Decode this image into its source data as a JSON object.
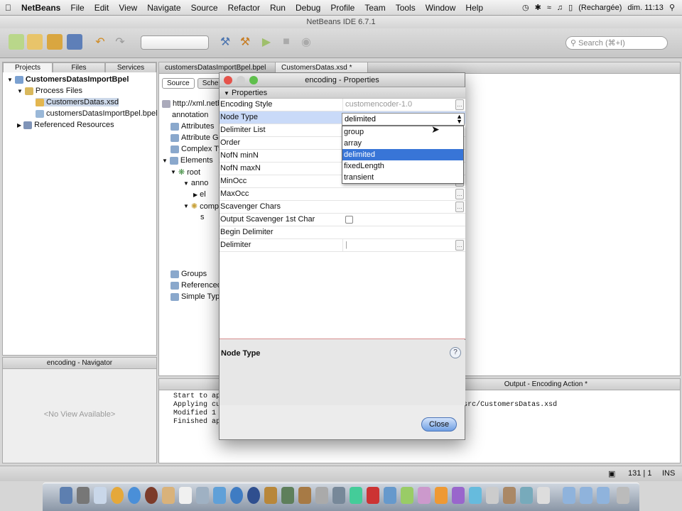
{
  "menubar": {
    "app": "NetBeans",
    "items": [
      "File",
      "Edit",
      "View",
      "Navigate",
      "Source",
      "Refactor",
      "Run",
      "Debug",
      "Profile",
      "Team",
      "Tools",
      "Window",
      "Help"
    ],
    "battery": "(Rechargée)",
    "clock": "dim. 11:13"
  },
  "window": {
    "title": "NetBeans IDE 6.7.1"
  },
  "search": {
    "placeholder": "Search (⌘+I)"
  },
  "projects": {
    "tabs": [
      "Projects",
      "Files",
      "Services"
    ],
    "tree": [
      "CustomersDatasImportBpel",
      "Process Files",
      "CustomersDatas.xsd",
      "customersDatasImportBpel.bpel",
      "Referenced Resources"
    ]
  },
  "navigator": {
    "title": "encoding - Navigator",
    "empty": "<No View Available>"
  },
  "editor": {
    "tabs": [
      "customersDatasImportBpel.bpel",
      "CustomersDatas.xsd *"
    ],
    "subtabs": [
      "Source",
      "Schema"
    ],
    "schema_items": [
      "http://xml.netb",
      "annotation",
      "Attributes",
      "Attribute Gr",
      "Complex Ty",
      "Elements",
      "root",
      "anno",
      "el",
      "comp",
      "s",
      "Groups",
      "Referenced",
      "Simple Type"
    ]
  },
  "output": {
    "title": "Output - Encoding Action *",
    "lines": [
      "Start to ap",
      "Applying cu",
      "Modified 1",
      "Finished ap"
    ],
    "path_tail": "stomersDatasImportBpel/src/CustomersDatas.xsd"
  },
  "statusbar": {
    "position": "131 | 1",
    "mode": "INS"
  },
  "dialog": {
    "title": "encoding - Properties",
    "category": "Properties",
    "rows": [
      {
        "name": "Encoding Style",
        "value": "customencoder-1.0"
      },
      {
        "name": "Node Type",
        "value": "delimited"
      },
      {
        "name": "Delimiter List",
        "value": ""
      },
      {
        "name": "Order",
        "value": ""
      },
      {
        "name": "NofN minN",
        "value": ""
      },
      {
        "name": "NofN maxN",
        "value": ""
      },
      {
        "name": "MinOcc",
        "value": ""
      },
      {
        "name": "MaxOcc",
        "value": ""
      },
      {
        "name": "Scavenger Chars",
        "value": ""
      },
      {
        "name": "Output Scavenger 1st Char",
        "value": ""
      },
      {
        "name": "Begin Delimiter",
        "value": ""
      },
      {
        "name": "Delimiter",
        "value": "|"
      }
    ],
    "dropdown_options": [
      "group",
      "array",
      "delimited",
      "fixedLength",
      "transient"
    ],
    "selected_option": "delimited",
    "description_title": "Node Type",
    "help": "?",
    "close_label": "Close"
  }
}
